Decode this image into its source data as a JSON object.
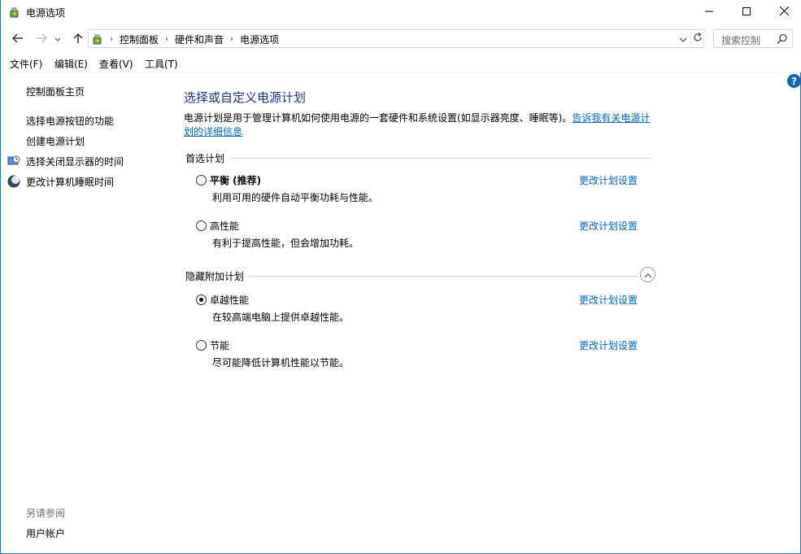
{
  "window": {
    "title": "电源选项",
    "controls": {
      "minimize": "minimize-icon",
      "maximize": "maximize-icon",
      "close": "close-icon"
    }
  },
  "nav": {
    "breadcrumbs": [
      "控制面板",
      "硬件和声音",
      "电源选项"
    ],
    "search_placeholder": "搜索控制"
  },
  "menu": [
    "文件(F)",
    "编辑(E)",
    "查看(V)",
    "工具(T)"
  ],
  "sidebar": {
    "items": [
      {
        "label": "控制面板主页",
        "icon": ""
      },
      {
        "label": "选择电源按钮的功能",
        "icon": ""
      },
      {
        "label": "创建电源计划",
        "icon": ""
      },
      {
        "label": "选择关闭显示器的时间",
        "icon": "monitor-clock-icon"
      },
      {
        "label": "更改计算机睡眠时间",
        "icon": "moon-icon"
      }
    ],
    "see_also": "另请参阅",
    "see_also_items": [
      "用户帐户"
    ]
  },
  "main": {
    "heading": "选择或自定义电源计划",
    "description": "电源计划是用于管理计算机如何使用电源的一套硬件和系统设置(如显示器亮度、睡眠等)。",
    "description_link": "告诉我有关电源计划的详细信息",
    "preferred_section": "首选计划",
    "hidden_section": "隐藏附加计划",
    "change_link": "更改计划设置",
    "plans": [
      {
        "name": "平衡 (推荐)",
        "desc": "利用可用的硬件自动平衡功耗与性能。",
        "selected": false,
        "bold": true
      },
      {
        "name": "高性能",
        "desc": "有利于提高性能，但会增加功耗。",
        "selected": false,
        "bold": false
      },
      {
        "name": "卓越性能",
        "desc": "在较高端电脑上提供卓越性能。",
        "selected": true,
        "bold": false
      },
      {
        "name": "节能",
        "desc": "尽可能降低计算机性能以节能。",
        "selected": false,
        "bold": false
      }
    ]
  },
  "colors": {
    "heading": "#1e3287",
    "link": "#0066cc",
    "help_button": "#1466b8"
  }
}
